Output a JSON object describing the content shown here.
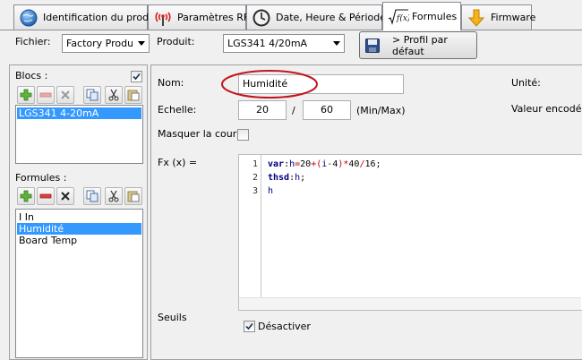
{
  "tabs": [
    {
      "label": "Identification du produit",
      "icon": "globe-icon",
      "active": false
    },
    {
      "label": "Paramètres RF",
      "icon": "antenna-icon",
      "active": false
    },
    {
      "label": "Date, Heure & Périodes",
      "icon": "clock-icon",
      "active": false
    },
    {
      "label": "Formules",
      "icon": "sqrt-fx-icon",
      "active": true
    },
    {
      "label": "Firmware",
      "icon": "download-arrow-icon",
      "active": false
    }
  ],
  "toolbar": {
    "file_label": "Fichier:",
    "file_value": "Factory Product",
    "product_label": "Produit:",
    "product_value": "LGS341 4/20mA",
    "default_profile_button": "> Profil par défaut"
  },
  "blocks": {
    "label": "Blocs :",
    "checked": true,
    "items": [
      "LGS341 4-20mA"
    ],
    "selected_index": 0
  },
  "formulas": {
    "label": "Formules :",
    "items": [
      "I In",
      "Humidité",
      "Board Temp"
    ],
    "selected_index": 1
  },
  "form": {
    "name_label": "Nom:",
    "name_value": "Humidité",
    "scale_label": "Echelle:",
    "scale_min": "20",
    "scale_sep": "/",
    "scale_max": "60",
    "scale_hint": "(Min/Max)",
    "hide_curve_label": "Masquer la courbe",
    "hide_curve_checked": false,
    "fx_label": "Fx (x) =",
    "unit_label": "Unité:",
    "encoded_value_label": "Valeur encodée",
    "thresholds_label": "Seuils",
    "disable_label": "Désactiver",
    "disable_checked": true
  },
  "editor": {
    "line_numbers": [
      "1",
      "2",
      "3"
    ],
    "lines": [
      "var:h=20+(i-4)*40/16;",
      "thsd:h;",
      "h"
    ]
  },
  "colors": {
    "selection": "#3399ff",
    "highlight_ellipse": "#c0171d",
    "keyword": "#000080",
    "operator": "#c00000"
  }
}
